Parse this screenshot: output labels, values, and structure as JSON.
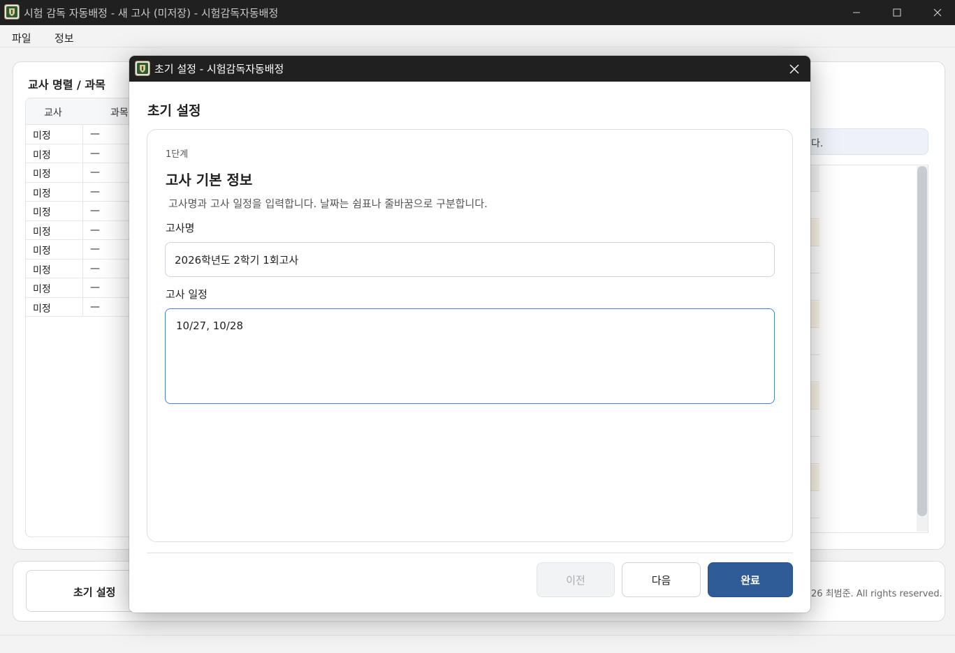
{
  "window": {
    "title": "시험 감독 자동배정 - 새 고사 (미저장) - 시험감독자동배정",
    "icon": "app-shield-icon"
  },
  "menu": {
    "items": [
      "파일",
      "정보"
    ]
  },
  "left_panel": {
    "title": "교사 명렬 / 과목",
    "columns": [
      "교사",
      "과목"
    ],
    "rows": [
      {
        "teacher": "미정",
        "subject": "—"
      },
      {
        "teacher": "미정",
        "subject": "—"
      },
      {
        "teacher": "미정",
        "subject": "—"
      },
      {
        "teacher": "미정",
        "subject": "—"
      },
      {
        "teacher": "미정",
        "subject": "—"
      },
      {
        "teacher": "미정",
        "subject": "—"
      },
      {
        "teacher": "미정",
        "subject": "—"
      },
      {
        "teacher": "미정",
        "subject": "—"
      },
      {
        "teacher": "미정",
        "subject": "—"
      },
      {
        "teacher": "미정",
        "subject": "—"
      }
    ]
  },
  "right_panel": {
    "info_text_visible": "다."
  },
  "bottom": {
    "setup_button": "초기 설정",
    "copyright_visible": "26 최범준. All rights reserved."
  },
  "dialog": {
    "title": "초기 설정 - 시험감독자동배정",
    "heading": "초기 설정",
    "step_label": "1단계",
    "step_title": "고사 기본 정보",
    "step_description": "고사명과 고사 일정을 입력합니다. 날짜는 쉼표나 줄바꿈으로 구분합니다.",
    "exam_name_label": "고사명",
    "exam_name_value": "2026학년도 2학기 1회고사",
    "schedule_label": "고사 일정",
    "schedule_value": "10/27, 10/28",
    "buttons": {
      "prev": "이전",
      "next": "다음",
      "done": "완료"
    },
    "colors": {
      "primary": "#2f5c97",
      "focus_border": "#4a7fd0",
      "titlebar": "#202020"
    }
  }
}
